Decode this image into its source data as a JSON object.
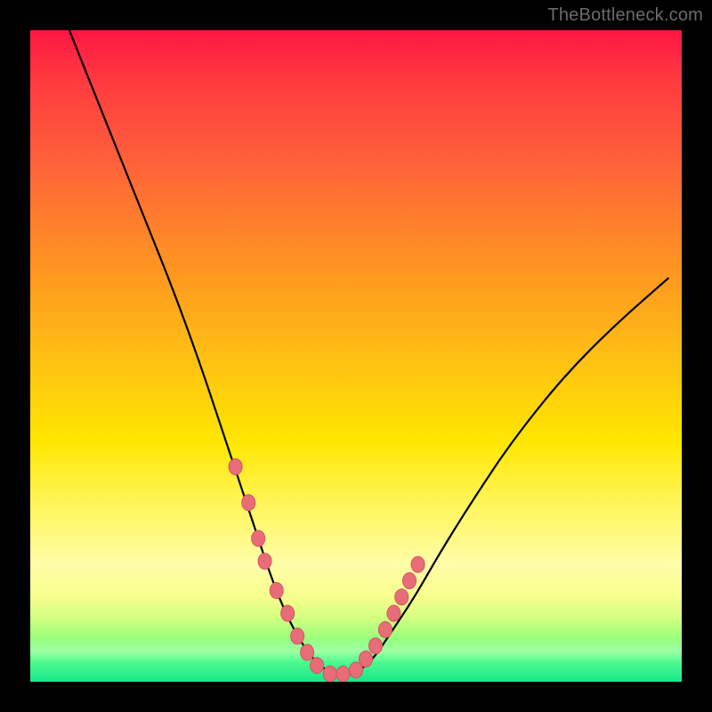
{
  "watermark": "TheBottleneck.com",
  "colors": {
    "gradient_top": "#ff1744",
    "gradient_mid": "#ffe600",
    "gradient_bottom": "#17e88a",
    "curve": "#000000",
    "marker_fill": "#e86d78",
    "marker_stroke": "#d4545f",
    "frame": "#000000"
  },
  "chart_data": {
    "type": "line",
    "title": "",
    "xlabel": "",
    "ylabel": "",
    "xlim": [
      0,
      100
    ],
    "ylim": [
      0,
      100
    ],
    "grid": false,
    "series": [
      {
        "name": "bottleneck-curve",
        "x": [
          6,
          10,
          14,
          18,
          22,
          26,
          29,
          31,
          33,
          35,
          37,
          39,
          41,
          43,
          45,
          47,
          49,
          51,
          53,
          55,
          59,
          63,
          68,
          74,
          82,
          90,
          98
        ],
        "y": [
          100,
          90,
          80,
          70,
          60,
          49,
          40,
          34,
          28,
          22,
          16,
          11,
          7,
          4,
          2,
          1,
          1,
          2,
          4,
          7,
          13,
          20,
          28,
          37,
          47,
          55,
          62
        ]
      }
    ],
    "markers": {
      "name": "highlight-dots",
      "x": [
        31.5,
        33.5,
        35,
        36,
        37.8,
        39.5,
        41,
        42.5,
        44,
        46,
        48,
        50,
        51.5,
        53,
        54.5,
        55.8,
        57,
        58.2,
        59.5
      ],
      "y": [
        33,
        27.5,
        22,
        18.5,
        14,
        10.5,
        7,
        4.5,
        2.5,
        1.2,
        1.2,
        1.8,
        3.5,
        5.5,
        8,
        10.5,
        13,
        15.5,
        18
      ]
    }
  }
}
